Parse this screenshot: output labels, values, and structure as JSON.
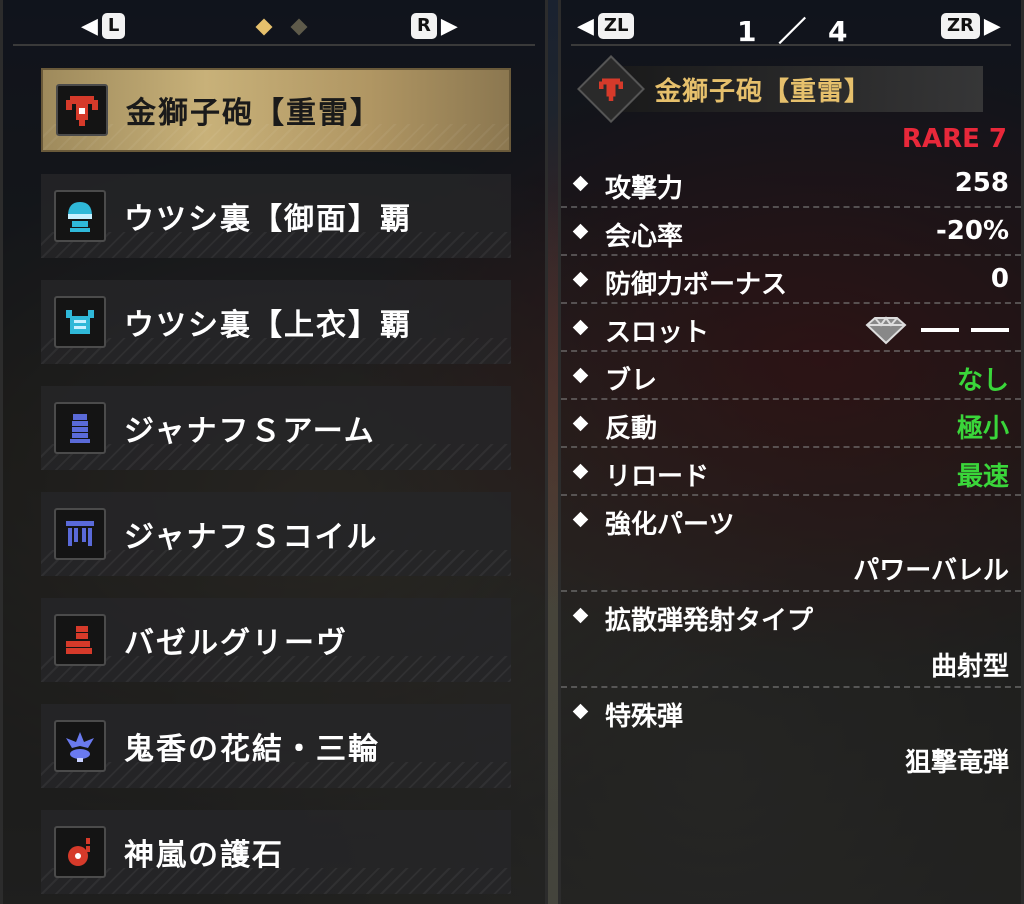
{
  "left": {
    "prev_key": "L",
    "next_key": "R",
    "items": [
      {
        "label": "金獅子砲【重雷】"
      },
      {
        "label": "ウツシ裏【御面】覇"
      },
      {
        "label": "ウツシ裏【上衣】覇"
      },
      {
        "label": "ジャナフＳアーム"
      },
      {
        "label": "ジャナフＳコイル"
      },
      {
        "label": "バゼルグリーヴ"
      },
      {
        "label": "鬼香の花結・三輪"
      },
      {
        "label": "神嵐の護石"
      }
    ]
  },
  "right": {
    "prev_key": "ZL",
    "next_key": "ZR",
    "page": "1 ／ 4",
    "title": "金獅子砲【重雷】",
    "rarity": "RARE 7",
    "stats": {
      "attack_label": "攻撃力",
      "attack_value": "258",
      "affinity_label": "会心率",
      "affinity_value": "-20%",
      "defense_label": "防御力ボーナス",
      "defense_value": "0",
      "slot_label": "スロット",
      "deviation_label": "ブレ",
      "deviation_value": "なし",
      "recoil_label": "反動",
      "recoil_value": "極小",
      "reload_label": "リロード",
      "reload_value": "最速",
      "mod_label": "強化パーツ",
      "mod_value": "パワーバレル",
      "spread_label": "拡散弾発射タイプ",
      "spread_value": "曲射型",
      "special_label": "特殊弾",
      "special_value": "狙撃竜弾"
    }
  },
  "colors": {
    "accent_gold": "#e6c06c",
    "rare_red": "#e8283a",
    "value_green": "#3ad63a"
  }
}
